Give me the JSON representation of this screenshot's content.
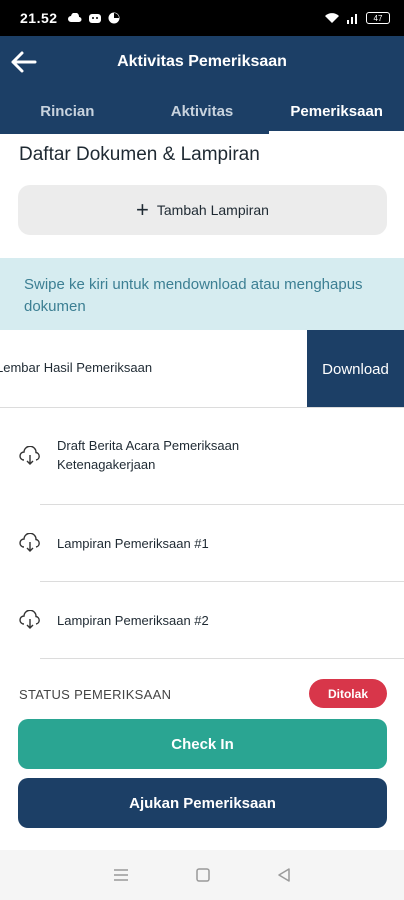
{
  "status_bar": {
    "time": "21.52",
    "battery": "47",
    "icons": [
      "cloud-icon",
      "face-icon",
      "pie-icon",
      "wifi-icon",
      "signal-icon",
      "battery-icon"
    ]
  },
  "app_bar": {
    "title": "Aktivitas Pemeriksaan",
    "back_icon": "arrow-left-icon"
  },
  "tabs": [
    {
      "label": "Rincian",
      "active": false
    },
    {
      "label": "Aktivitas",
      "active": false
    },
    {
      "label": "Pemeriksaan",
      "active": true
    }
  ],
  "documents_section": {
    "title": "Daftar Dokumen & Lampiran",
    "add_button_label": "Tambah Lampiran",
    "info_text": "Swipe ke kiri untuk mendownload atau menghapus dokumen",
    "swiped_item": {
      "label": "Lembar Hasil Pemeriksaan",
      "action_label": "Download"
    },
    "items": [
      {
        "label": "Draft Berita Acara Pemeriksaan Ketenagakerjaan",
        "icon": "cloud-download-icon"
      },
      {
        "label": "Lampiran Pemeriksaan #1",
        "icon": "cloud-download-icon"
      },
      {
        "label": "Lampiran Pemeriksaan #2",
        "icon": "cloud-download-icon"
      }
    ]
  },
  "footer": {
    "status_label": "STATUS PEMERIKSAAN",
    "status_badge": "Ditolak",
    "check_in_label": "Check In",
    "submit_label": "Ajukan Pemeriksaan"
  },
  "colors": {
    "primary": "#1c3f66",
    "accent_green": "#2aa592",
    "danger": "#d8364a",
    "info_bg": "#d6ecf0",
    "info_text": "#3c7f93"
  },
  "nav_bar": {
    "icons": [
      "menu-icon",
      "home-square-icon",
      "back-triangle-icon"
    ]
  }
}
